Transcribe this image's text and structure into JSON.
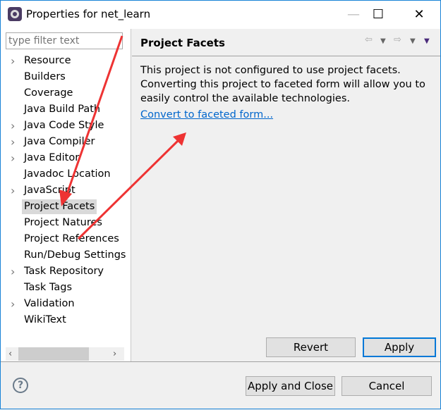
{
  "window": {
    "title": "Properties for net_learn",
    "minimize": "—",
    "maximize": "☐",
    "close": "✕"
  },
  "filter": {
    "placeholder": "type filter text"
  },
  "tree": [
    {
      "label": "Resource",
      "expandable": true
    },
    {
      "label": "Builders",
      "expandable": false
    },
    {
      "label": "Coverage",
      "expandable": false
    },
    {
      "label": "Java Build Path",
      "expandable": false
    },
    {
      "label": "Java Code Style",
      "expandable": true
    },
    {
      "label": "Java Compiler",
      "expandable": true
    },
    {
      "label": "Java Editor",
      "expandable": true
    },
    {
      "label": "Javadoc Location",
      "expandable": false
    },
    {
      "label": "JavaScript",
      "expandable": true
    },
    {
      "label": "Project Facets",
      "expandable": false,
      "selected": true
    },
    {
      "label": "Project Natures",
      "expandable": false
    },
    {
      "label": "Project References",
      "expandable": false
    },
    {
      "label": "Run/Debug Settings",
      "expandable": false
    },
    {
      "label": "Task Repository",
      "expandable": true
    },
    {
      "label": "Task Tags",
      "expandable": false
    },
    {
      "label": "Validation",
      "expandable": true
    },
    {
      "label": "WikiText",
      "expandable": false
    }
  ],
  "page": {
    "title": "Project Facets",
    "message": "This project is not configured to use project facets. Converting this project to faceted form will allow you to easily control the available technologies.",
    "link": "Convert to faceted form..."
  },
  "buttons": {
    "revert": "Revert",
    "apply": "Apply",
    "apply_close": "Apply and Close",
    "cancel": "Cancel"
  },
  "colors": {
    "accent": "#0078d7",
    "link": "#0066cc",
    "annotation": "#ee3333"
  }
}
